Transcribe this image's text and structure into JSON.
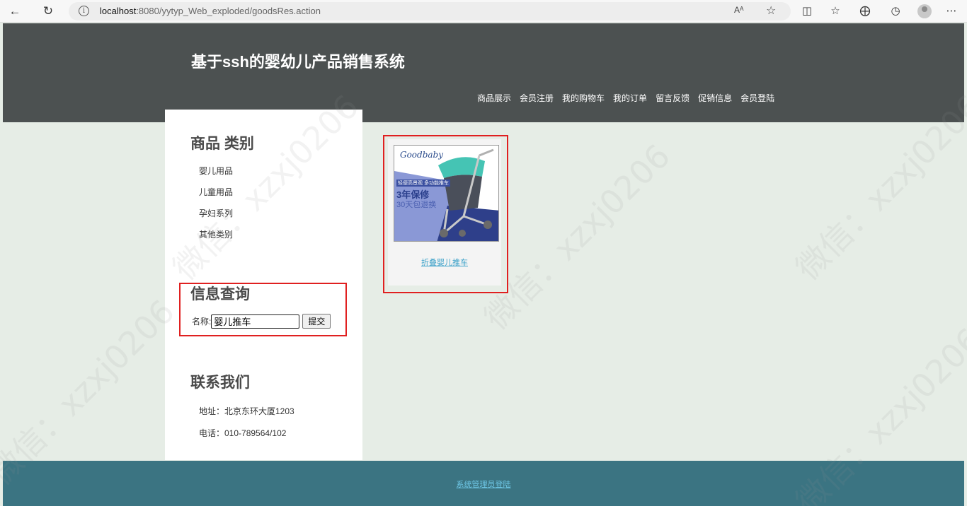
{
  "browser": {
    "url_host": "localhost",
    "url_path": ":8080/yytyp_Web_exploded/goodsRes.action",
    "read_aloud": "Aᴬ"
  },
  "header": {
    "title": "基于ssh的婴幼儿产品销售系统",
    "nav": [
      "商品展示",
      "会员注册",
      "我的购物车",
      "我的订单",
      "留言反馈",
      "促销信息",
      "会员登陆"
    ]
  },
  "sidebar": {
    "category_heading": "商品 类别",
    "categories": [
      "婴儿用品",
      "儿童用品",
      "孕妇系列",
      "其他类别"
    ],
    "search_heading": "信息查询",
    "search_label": "名称:",
    "search_value": "婴儿推车",
    "submit_label": "提交",
    "contact_heading": "联系我们",
    "address": "地址：北京东环大厦1203",
    "phone": "电话：010-789564/102"
  },
  "product": {
    "name": "折叠婴儿推车",
    "image_texts": {
      "brand": "Goodbaby",
      "tag1": "轻便高景观 多功能推车",
      "tag2": "3年保修",
      "tag3": "30天包退换"
    }
  },
  "footer": {
    "admin_link": "系统管理员登陆"
  },
  "watermark": "微信：xzxj0206",
  "colors": {
    "header_bg": "#4c5151",
    "footer_bg": "#3b7482",
    "page_bg": "#e6ede6",
    "highlight": "#e02020",
    "link": "#3aa0c8"
  }
}
